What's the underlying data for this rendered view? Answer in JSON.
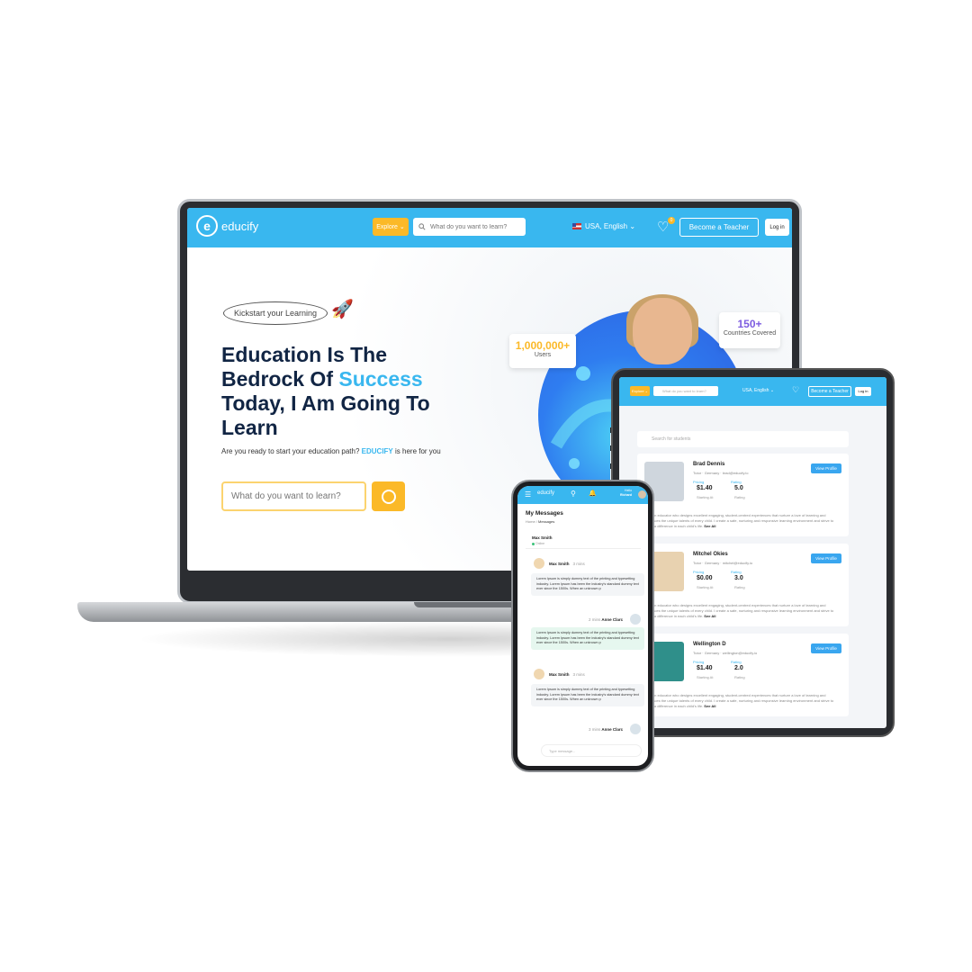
{
  "laptop": {
    "logo_text": "educify",
    "logo_mark": "e",
    "explore_label": "Explore ⌄",
    "search_placeholder": "What do you want to learn?",
    "language": "USA, English ⌄",
    "wishlist_count": "0",
    "become_teacher": "Become a Teacher",
    "login": "Log in",
    "kickstart": "Kickstart your Learning",
    "headline_1": "Education Is The",
    "headline_2": "Bedrock Of ",
    "headline_highlight": "Success",
    "headline_3": "Today, I Am Going To",
    "headline_4": "Learn",
    "subtitle_pre": "Are you ready to start your education path? ",
    "subtitle_brand": "EDUCIFY",
    "subtitle_post": " is here for you",
    "hero_search_placeholder": "What do you want to learn?",
    "stat_users_value": "1,000,000+",
    "stat_users_label": "Users",
    "stat_countries_value": "150+",
    "stat_countries_label": "Countries Covered"
  },
  "tablet": {
    "explore_label": "Explore ⌄",
    "search_placeholder": "What do you want to learn?",
    "language": "USA, English ⌄",
    "become_teacher": "Become a Teacher",
    "login": "Log in",
    "filter_placeholder": "Search for students",
    "price_label": "Pricing",
    "rating_label": "Rating",
    "price_sub": "Starting At",
    "rating_sub": "Rating",
    "view_profile": "View Profile",
    "see_all": "See All",
    "description": "I am an educator who designs excellent engaging, student-centred experiences that nurture a love of learning and embraces the unique talents of every child. I create a safe, nurturing and responsive learning environment and strive to make a difference in each child's life.",
    "tutors": [
      {
        "name": "Brad Dennis",
        "meta": "Tutor  ·  Germany  ·  brad@educify.io",
        "price": "$1.40",
        "rating": "5.0"
      },
      {
        "name": "Mitchel Okies",
        "meta": "Tutor  ·  Germany  ·  mitchel@educify.io",
        "price": "$0.00",
        "rating": "3.0"
      },
      {
        "name": "Wellington D",
        "meta": "Tutor  ·  Germany  ·  wellington@educify.io",
        "price": "$1.40",
        "rating": "2.0"
      }
    ]
  },
  "phone": {
    "logo_text": "educify",
    "user_greeting": "Hello",
    "user_name": "Richard",
    "title": "My Messages",
    "crumb_home": "Home",
    "crumb_current": "Messages",
    "contact_name": "Max Smith",
    "contact_status": "Online",
    "type_placeholder": "Type message...",
    "messages": [
      {
        "sender": "Max Smith",
        "time": "3 mins",
        "text": "Lorem Ipsum is simply dummy  text of the printing and typesetting industry. Lorem Ipsum has been the industry's standard dummy text ever since the 1500s. When an unknown p"
      },
      {
        "sender": "Anne Clarc",
        "time": "2 mins",
        "text": "Lorem Ipsum is simply dummy  text of the printing and typesetting industry. Lorem Ipsum has been the industry's standard dummy text ever since the 1500s. When an unknown p"
      },
      {
        "sender": "Max Smith",
        "time": "3 mins",
        "text": "Lorem Ipsum is simply dummy  text of the printing and typesetting industry. Lorem Ipsum has been the industry's standard dummy text ever since the 1500s. When an unknown p"
      },
      {
        "sender": "Anne Clarc",
        "time": "3 mins",
        "text": ""
      }
    ]
  },
  "colors": {
    "brand_blue": "#39b7ef",
    "accent_yellow": "#fbb928",
    "navy": "#112544"
  }
}
